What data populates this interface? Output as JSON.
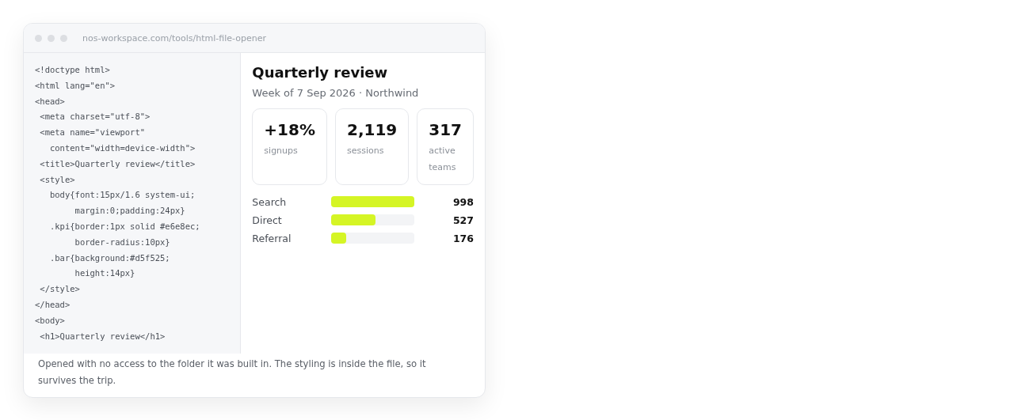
{
  "window": {
    "address": "nos-workspace.com/tools/html-file-opener"
  },
  "source_lines": [
    "<!doctype html>",
    "<html lang=\"en\">",
    "<head>",
    " <meta charset=\"utf-8\">",
    " <meta name=\"viewport\"",
    "   content=\"width=device-width\">",
    " <title>Quarterly review</title>",
    " <style>",
    "   body{font:15px/1.6 system-ui;",
    "        margin:0;padding:24px}",
    "   .kpi{border:1px solid #e6e8ec;",
    "        border-radius:10px}",
    "   .bar{background:#d5f525;",
    "        height:14px}",
    " </style>",
    "</head>",
    "<body>",
    " <h1>Quarterly review</h1>"
  ],
  "preview": {
    "title": "Quarterly review",
    "subtitle": "Week of 7 Sep 2026 · Northwind",
    "kpis": [
      {
        "value": "+18%",
        "label": "signups"
      },
      {
        "value": "2,119",
        "label": "sessions"
      },
      {
        "value": "317",
        "label": "active teams"
      }
    ],
    "bars": [
      {
        "label": "Search",
        "level": 1,
        "value": "998"
      },
      {
        "label": "Direct",
        "level": 0.53,
        "value": "527"
      },
      {
        "label": "Referral",
        "level": 0.18,
        "value": "176"
      }
    ]
  },
  "caption": "Opened with no access to the folder it was built in. The styling is inside the file, so it survives the trip."
}
